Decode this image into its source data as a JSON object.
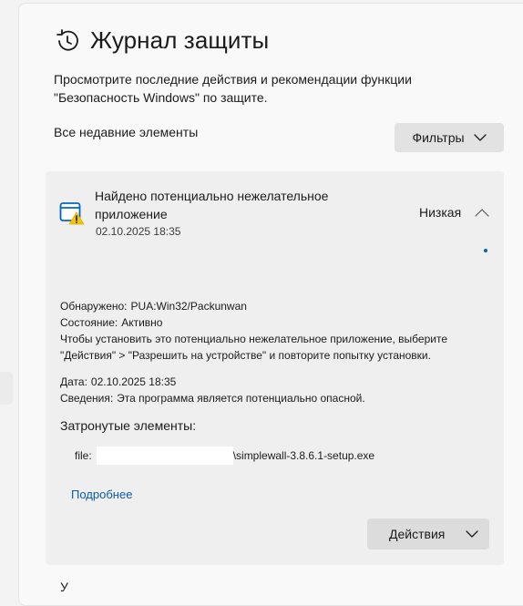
{
  "page": {
    "title": "Журнал защиты",
    "subtitle": "Просмотрите последние действия и рекомендации функции \"Безопасность Windows\" по защите.",
    "recent_label": "Все недавние элементы",
    "filters_label": "Фильтры"
  },
  "icons": {
    "title": "history-clock-icon",
    "card": "window-warning-icon",
    "chevrons": "chevron-icon"
  },
  "colors": {
    "accent": "#0067c0",
    "warning": "#f1c40f",
    "card_bg": "#efefef",
    "link": "#0a5ca8"
  },
  "card": {
    "title": "Найдено потенциально нежелательное приложение",
    "date": "02.10.2025 18:35",
    "severity": "Низкая",
    "detected_key": "Обнаружено:",
    "detected_val": "PUA:Win32/Packunwan",
    "state_key": "Состояние:",
    "state_val": "Активно",
    "instruction": "Чтобы установить это потенциально нежелательное приложение, выберите \"Действия\" > \"Разрешить на устройстве\" и повторите попытку установки.",
    "date_key": "Дата:",
    "date_val": "02.10.2025 18:35",
    "info_key": "Сведения:",
    "info_val": "Эта программа является потенциально опасной.",
    "affected_title": "Затронутые элементы:",
    "file_prefix": "file:",
    "file_name": "\\simplewall-3.8.6.1-setup.exe",
    "more_link": "Подробнее",
    "actions_label": "Действия"
  },
  "next_item_label": "У"
}
